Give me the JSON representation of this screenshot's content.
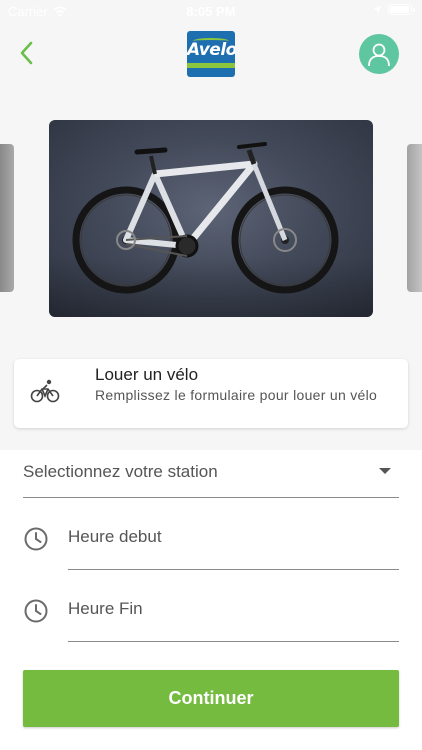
{
  "status_bar": {
    "carrier": "Carrier",
    "time": "8:05 PM"
  },
  "header": {
    "back_icon": "chevron-left-icon",
    "logo_text": "Avelo",
    "avatar_icon": "user-icon",
    "colors": {
      "back": "#6abf4b",
      "avatar_bg": "#5ec6a0"
    }
  },
  "rent_card": {
    "icon": "bicycle-icon",
    "title": "Louer un vélo",
    "subtitle": "Remplissez le formulaire pour louer un vélo"
  },
  "form": {
    "station_label": "Selectionnez votre station",
    "start_label": "Heure debut",
    "end_label": "Heure Fin",
    "time_icon": "clock-icon"
  },
  "actions": {
    "continue_label": "Continuer",
    "continue_color": "#74bb3f"
  }
}
